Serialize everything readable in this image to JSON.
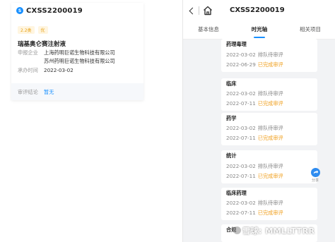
{
  "left": {
    "code": "CXSS2200019",
    "badges": [
      "2.2类",
      "优"
    ],
    "drug_name": "瑞基奥仑赛注射液",
    "applicant_label": "申报企业",
    "applicant_1": "上海药明巨诺生物科技有限公司",
    "applicant_2": "苏州药明巨诺生物科技有限公司",
    "date_label": "承办时间",
    "date_value": "2022-03-02",
    "review_label": "审评结论",
    "review_value": "暂无"
  },
  "right": {
    "title": "CXSS2200019",
    "tabs": [
      "基本信息",
      "时光轴",
      "相关项目"
    ],
    "active_tab": "时光轴",
    "timeline": [
      {
        "title": "药理毒理",
        "line1_date": "2022-03-02",
        "line1_status": "排队待审评",
        "line2_date": "2022-06-29",
        "line2_status": "已完成审评"
      },
      {
        "title": "临床",
        "line1_date": "2022-03-02",
        "line1_status": "排队待审评",
        "line2_date": "2022-07-11",
        "line2_status": "已完成审评"
      },
      {
        "title": "药学",
        "line1_date": "2022-03-02",
        "line1_status": "排队待审评",
        "line2_date": "2022-07-11",
        "line2_status": "已完成审评"
      },
      {
        "title": "统计",
        "line1_date": "2022-03-02",
        "line1_status": "排队待审评",
        "line2_date": "2022-07-11",
        "line2_status": "已完成审评"
      },
      {
        "title": "临床药理",
        "line1_date": "2022-03-02",
        "line1_status": "排队待审评",
        "line2_date": "2022-07-11",
        "line2_status": "已完成审评"
      },
      {
        "title": "合规"
      }
    ],
    "share_label": "分享"
  },
  "watermark": "雪球: MMLLTTRR",
  "colors": {
    "accent": "#1890ff",
    "done": "#f0a020",
    "panel_bg": "#f2f3f5"
  }
}
